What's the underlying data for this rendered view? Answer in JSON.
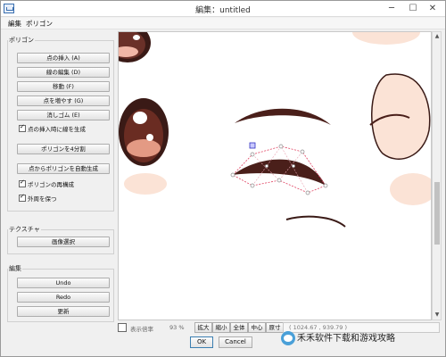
{
  "window": {
    "title": "編集：untitled",
    "minimize": "─",
    "maximize": "☐",
    "close": "✕"
  },
  "menu": {
    "items": [
      "編集",
      "ポリゴン"
    ]
  },
  "polygon_panel": {
    "group_label": "ポリゴン",
    "buttons": [
      "点の挿入 (A)",
      "線の編集 (D)",
      "移動 (F)",
      "点を増やす (G)",
      "消しゴム (E)"
    ],
    "check_insert_line": {
      "label": "点の挿入時に線を生成",
      "checked": true
    },
    "split_button": "ポリゴンを4分割",
    "auto_generate_button": "点からポリゴンを自動生成",
    "check_restructure": {
      "label": "ポリゴンの再構成",
      "checked": true
    },
    "check_keep_outline": {
      "label": "外周を保つ",
      "checked": true
    }
  },
  "texture_panel": {
    "group_label": "テクスチャ",
    "select_image_button": "画像選択"
  },
  "edit_panel": {
    "group_label": "編集",
    "undo": "Undo",
    "redo": "Redo",
    "update": "更新"
  },
  "bottom_bar": {
    "zoom_label": "表示倍率",
    "zoom_value": "93 %",
    "zoom_in": "拡大",
    "zoom_out": "縮小",
    "fit_all": "全体",
    "center": "中心",
    "actual_size": "原寸",
    "coordinates": "( 1024.67 , 939.79 )"
  },
  "footer": {
    "ok": "OK",
    "cancel": "Cancel"
  },
  "watermark": {
    "text": "禾禾软件下载和游戏攻略"
  },
  "colors": {
    "accent": "#3c7fb1",
    "polygon_outline": "#e04060",
    "selected_vertex": "#3030c0",
    "skin": "#fbe3d6",
    "eye_dark": "#4a1f1a"
  }
}
